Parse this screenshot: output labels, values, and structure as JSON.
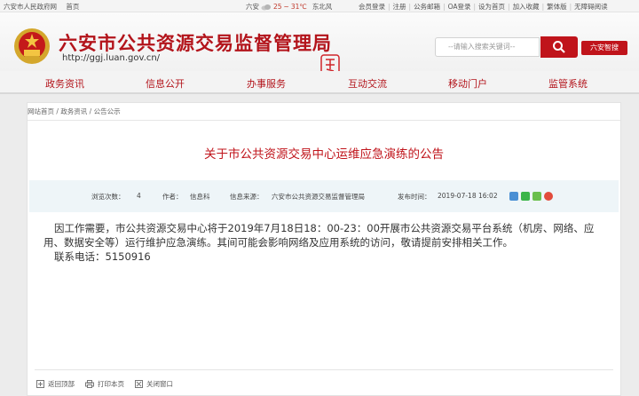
{
  "topbar": {
    "gov_link": "六安市人民政府网",
    "home_link": "首页",
    "city": "六安",
    "temp_high": "25",
    "temp_low": "31℃",
    "wind": "东北风",
    "links": [
      "会员登录",
      "注册",
      "公务邮箱",
      "OA登录",
      "设为首页",
      "加入收藏",
      "繁体版",
      "无障碍阅读"
    ]
  },
  "header": {
    "title": "六安市公共资源交易监督管理局",
    "url": "http://ggj.luan.gov.cn/",
    "search_placeholder": "--请输入搜索关键词--",
    "mobile_button": "六安智搜"
  },
  "nav": {
    "items": [
      "政务资讯",
      "信息公开",
      "办事服务",
      "互动交流",
      "移动门户",
      "监管系统"
    ]
  },
  "breadcrumb": {
    "home": "网站首页",
    "level1": "政务资讯",
    "level2": "公告公示"
  },
  "article": {
    "title": "关于市公共资源交易中心运维应急演练的公告",
    "views_label": "浏览次数：",
    "views": "4",
    "author_label": "作者：",
    "author": "信息科",
    "source_label": "信息来源：",
    "source": "六安市公共资源交易监督管理局",
    "date_label": "发布时间：",
    "date": "2019-07-18 16:02",
    "paragraph": "因工作需要，市公共资源交易中心将于2019年7月18日18：00-23：00开展市公共资源交易平台系统（机房、网络、应用、数据安全等）运行维护应急演练。其间可能会影响网络及应用系统的访问，敬请提前安排相关工作。",
    "contact": "联系电话：5150916"
  },
  "footer": {
    "back_top": "返回顶部",
    "print": "打印本页",
    "close": "关闭窗口"
  },
  "colors": {
    "brand_red": "#c0141b",
    "info_bg": "#eef5f8"
  }
}
